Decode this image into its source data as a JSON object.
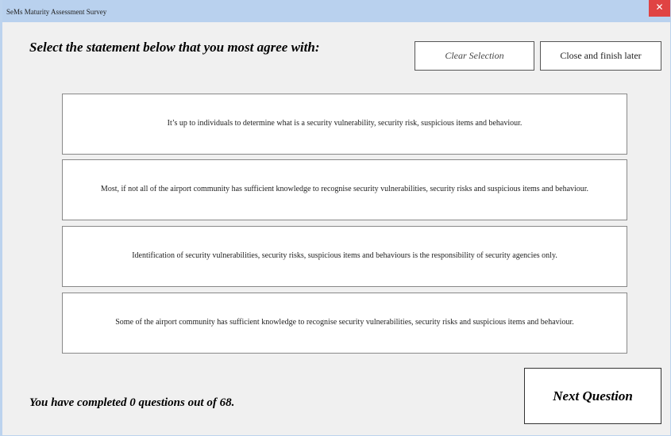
{
  "window": {
    "title": "SeMs Maturity Assessment Survey",
    "close_glyph": "✕"
  },
  "question": {
    "prompt": "Select the statement below that you most agree with:"
  },
  "toolbar": {
    "clear_label": "Clear Selection",
    "close_later_label": "Close and finish later"
  },
  "options": [
    "It’s up to individuals to determine what is a security vulnerability, security risk, suspicious items and behaviour.",
    "Most, if not all of the airport community has sufficient knowledge to recognise security vulnerabilities, security risks and suspicious items and behaviour.",
    "Identification of security vulnerabilities, security risks, suspicious items and behaviours is the responsibility of security agencies only.",
    "Some of the airport community has sufficient knowledge to recognise security vulnerabilities, security risks and suspicious items and behaviour."
  ],
  "footer": {
    "progress_text": "You have completed 0 questions out of 68.",
    "next_label": "Next Question"
  }
}
